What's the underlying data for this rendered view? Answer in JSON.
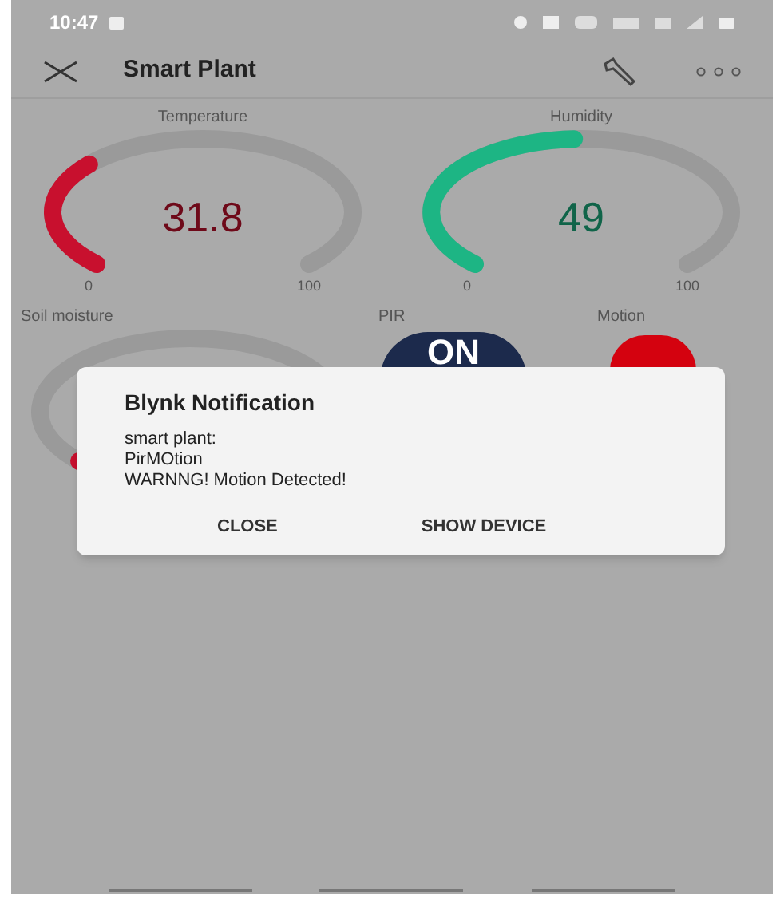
{
  "status_bar": {
    "time": "10:47"
  },
  "header": {
    "title": "Smart Plant"
  },
  "widgets": [
    {
      "kind": "gauge",
      "label": "Temperature",
      "value": "31.8",
      "min": "0",
      "max": "100",
      "color": "#c8102e"
    },
    {
      "kind": "gauge",
      "label": "Humidity",
      "value": "49",
      "min": "0",
      "max": "100",
      "color": "#1db584"
    },
    {
      "kind": "gauge",
      "label": "Soil moisture",
      "color": "#c8102e"
    },
    {
      "kind": "button",
      "label": "PIR",
      "text": "ON",
      "on": true
    },
    {
      "kind": "led",
      "label": "Motion",
      "on": true
    }
  ],
  "dialog": {
    "title": "Blynk Notification",
    "lines": [
      "smart plant:",
      "PirMOtion",
      "WARNNG! Motion Detected!"
    ],
    "buttons": [
      "CLOSE",
      "SHOW DEVICE"
    ]
  }
}
